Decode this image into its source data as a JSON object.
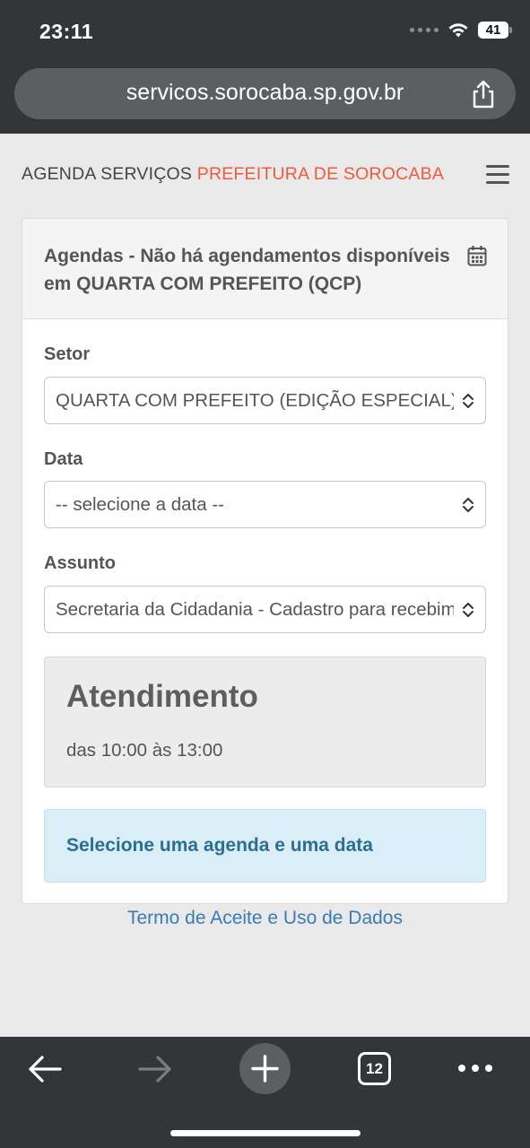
{
  "status_bar": {
    "time": "23:11",
    "battery": "41"
  },
  "browser": {
    "url": "servicos.sorocaba.sp.gov.br",
    "tab_count": "12"
  },
  "header": {
    "brand_prefix": "AGENDA SERVIÇOS ",
    "brand_accent": "PREFEITURA DE SOROCABA"
  },
  "card": {
    "title": "Agendas - Não há agendamentos disponíveis em QUARTA COM PREFEITO (QCP)",
    "fields": [
      {
        "label": "Setor",
        "value": "QUARTA COM PREFEITO (EDIÇÃO ESPECIAL)"
      },
      {
        "label": "Data",
        "value": "-- selecione a data --"
      },
      {
        "label": "Assunto",
        "value": "Secretaria da Cidadania - Cadastro para recebimento"
      }
    ],
    "info": {
      "title": "Atendimento",
      "hours": "das 10:00 às 13:00"
    },
    "alert": "Selecione uma agenda e uma data"
  },
  "footer": {
    "link": "Termo de Aceite e Uso de Dados"
  },
  "colors": {
    "accent": "#f05a3c",
    "link": "#3a7bb6",
    "alert_bg": "#d9eef7",
    "alert_text": "#2c6f91",
    "chrome": "#323639"
  },
  "icons": [
    "wifi-icon",
    "battery-icon",
    "share-icon",
    "menu-icon",
    "calendar-icon",
    "select-arrows-icon",
    "back-arrow-icon",
    "forward-arrow-icon",
    "new-tab-icon",
    "tabs-icon",
    "more-icon"
  ]
}
